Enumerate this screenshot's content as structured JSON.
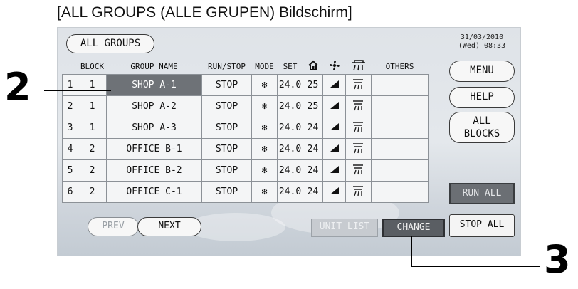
{
  "caption": "[ALL GROUPS (ALLE GRUPEN) Bildschirm]",
  "screen": {
    "title_button": "ALL GROUPS",
    "date": "31/03/2010",
    "time": "(Wed) 08:33",
    "columns": {
      "block": "BLOCK",
      "group_name": "GROUP NAME",
      "run_stop": "RUN/STOP",
      "mode": "MODE",
      "set": "SET",
      "others": "OTHERS"
    },
    "rows": [
      {
        "num": "1",
        "block": "1",
        "name": "SHOP A-1",
        "status": "STOP",
        "setpoint": "24.0",
        "room": "25",
        "selected": true
      },
      {
        "num": "2",
        "block": "1",
        "name": "SHOP A-2",
        "status": "STOP",
        "setpoint": "24.0",
        "room": "25"
      },
      {
        "num": "3",
        "block": "1",
        "name": "SHOP A-3",
        "status": "STOP",
        "setpoint": "24.0",
        "room": "24"
      },
      {
        "num": "4",
        "block": "2",
        "name": "OFFICE B-1",
        "status": "STOP",
        "setpoint": "24.0",
        "room": "24"
      },
      {
        "num": "5",
        "block": "2",
        "name": "OFFICE B-2",
        "status": "STOP",
        "setpoint": "24.0",
        "room": "24"
      },
      {
        "num": "6",
        "block": "2",
        "name": "OFFICE C-1",
        "status": "STOP",
        "setpoint": "24.0",
        "room": "24"
      }
    ],
    "menu_button": "MENU",
    "help_button": "HELP",
    "all_blocks_line1": "ALL",
    "all_blocks_line2": "BLOCKS",
    "run_all_button": "RUN ALL",
    "stop_all_button": "STOP ALL",
    "prev_button": "PREV",
    "next_button": "NEXT",
    "unit_list_button": "UNIT LIST",
    "change_button": "CHANGE"
  },
  "callouts": {
    "c2": "2",
    "c3": "3"
  },
  "colors": {
    "selected_row": "#6e7277",
    "run_all_bg": "#6b6f74",
    "change_bg": "#5a5e63",
    "unit_list_bg": "#c7cbd0"
  }
}
